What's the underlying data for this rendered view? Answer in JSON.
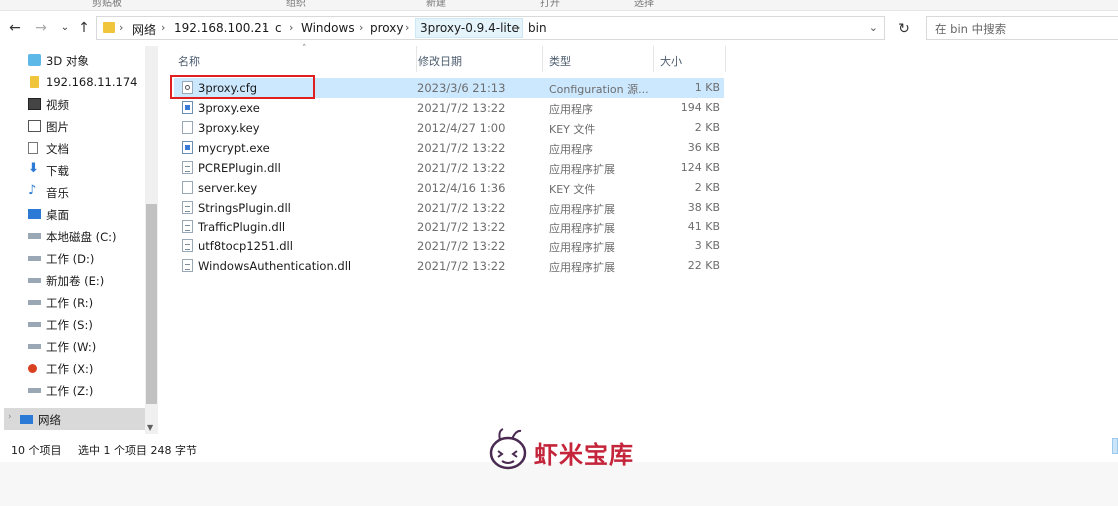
{
  "ribbon": {
    "labels": [
      "剪贴板",
      "组织",
      "新建",
      "打开",
      "选择"
    ]
  },
  "address": {
    "crumbs": [
      "网络",
      "192.168.100.21",
      "c",
      "Windows",
      "proxy",
      "3proxy-0.9.4-lite",
      "bin"
    ],
    "search_placeholder": "在 bin 中搜索"
  },
  "nav": {
    "items": [
      {
        "label": "3D 对象",
        "icon": "cube-icon"
      },
      {
        "label": "192.168.11.174",
        "icon": "folder-network-icon"
      },
      {
        "label": "视频",
        "icon": "video-icon"
      },
      {
        "label": "图片",
        "icon": "picture-icon"
      },
      {
        "label": "文档",
        "icon": "document-icon"
      },
      {
        "label": "下载",
        "icon": "download-icon"
      },
      {
        "label": "音乐",
        "icon": "music-icon"
      },
      {
        "label": "桌面",
        "icon": "desktop-icon"
      },
      {
        "label": "本地磁盘 (C:)",
        "icon": "drive-icon"
      },
      {
        "label": "工作 (D:)",
        "icon": "drive-icon"
      },
      {
        "label": "新加卷 (E:)",
        "icon": "drive-icon"
      },
      {
        "label": "工作 (R:)",
        "icon": "drive-icon"
      },
      {
        "label": "工作 (S:)",
        "icon": "drive-icon"
      },
      {
        "label": "工作 (W:)",
        "icon": "drive-icon"
      },
      {
        "label": "工作 (X:)",
        "icon": "drive-error-icon"
      },
      {
        "label": "工作 (Z:)",
        "icon": "drive-icon"
      }
    ],
    "network_label": "网络"
  },
  "columns": {
    "name": "名称",
    "date": "修改日期",
    "type": "类型",
    "size": "大小"
  },
  "files": [
    {
      "name": "3proxy.cfg",
      "date": "2023/3/6 21:13",
      "type": "Configuration 源...",
      "size": "1 KB",
      "icon": "cfg"
    },
    {
      "name": "3proxy.exe",
      "date": "2021/7/2 13:22",
      "type": "应用程序",
      "size": "194 KB",
      "icon": "exe"
    },
    {
      "name": "3proxy.key",
      "date": "2012/4/27 1:00",
      "type": "KEY 文件",
      "size": "2 KB",
      "icon": "page"
    },
    {
      "name": "mycrypt.exe",
      "date": "2021/7/2 13:22",
      "type": "应用程序",
      "size": "36 KB",
      "icon": "exe"
    },
    {
      "name": "PCREPlugin.dll",
      "date": "2021/7/2 13:22",
      "type": "应用程序扩展",
      "size": "124 KB",
      "icon": "dll"
    },
    {
      "name": "server.key",
      "date": "2012/4/16 1:36",
      "type": "KEY 文件",
      "size": "2 KB",
      "icon": "page"
    },
    {
      "name": "StringsPlugin.dll",
      "date": "2021/7/2 13:22",
      "type": "应用程序扩展",
      "size": "38 KB",
      "icon": "dll"
    },
    {
      "name": "TrafficPlugin.dll",
      "date": "2021/7/2 13:22",
      "type": "应用程序扩展",
      "size": "41 KB",
      "icon": "dll"
    },
    {
      "name": "utf8tocp1251.dll",
      "date": "2021/7/2 13:22",
      "type": "应用程序扩展",
      "size": "3 KB",
      "icon": "dll"
    },
    {
      "name": "WindowsAuthentication.dll",
      "date": "2021/7/2 13:22",
      "type": "应用程序扩展",
      "size": "22 KB",
      "icon": "dll"
    }
  ],
  "status": {
    "count": "10 个项目",
    "selected": "选中 1 个项目  248 字节"
  },
  "watermark": {
    "text": "虾米宝库"
  },
  "colors": {
    "selection": "#cce8ff",
    "highlight": "#e02020",
    "watermark": "#c4253a"
  }
}
